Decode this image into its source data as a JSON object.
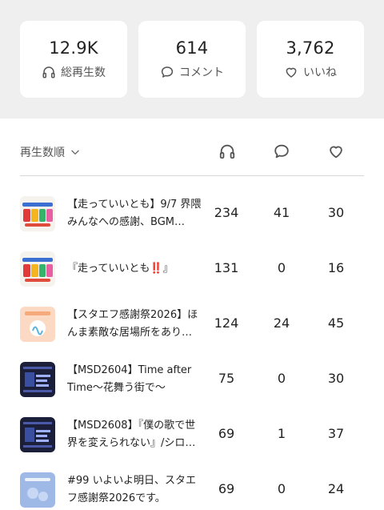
{
  "stats": [
    {
      "value": "12.9K",
      "label": "総再生数",
      "icon": "headphones-icon"
    },
    {
      "value": "614",
      "label": "コメント",
      "icon": "comment-icon"
    },
    {
      "value": "3,762",
      "label": "いいね",
      "icon": "heart-icon"
    }
  ],
  "list": {
    "sort_label": "再生数順",
    "rows": [
      {
        "title": "【走っていいとも】9/7 界隈みんなへの感謝、BGM…",
        "plays": "234",
        "comments": "41",
        "likes": "30",
        "thumb": "iitomo"
      },
      {
        "title": "『走っていいとも‼️』",
        "plays": "131",
        "comments": "0",
        "likes": "16",
        "thumb": "iitomo"
      },
      {
        "title": "【スタエフ感謝祭2026】ほんま素敵な居場所をあり…",
        "plays": "124",
        "comments": "24",
        "likes": "45",
        "thumb": "stand"
      },
      {
        "title": "【MSD2604】Time after Time〜花舞う街で〜",
        "plays": "75",
        "comments": "0",
        "likes": "30",
        "thumb": "msd"
      },
      {
        "title": "【MSD2608】『僕の歌で世界を変えられない』/シロ…",
        "plays": "69",
        "comments": "1",
        "likes": "37",
        "thumb": "msd"
      },
      {
        "title": "#99 いよいよ明日、スタエフ感謝祭2026です。",
        "plays": "69",
        "comments": "0",
        "likes": "24",
        "thumb": "blue"
      }
    ]
  }
}
